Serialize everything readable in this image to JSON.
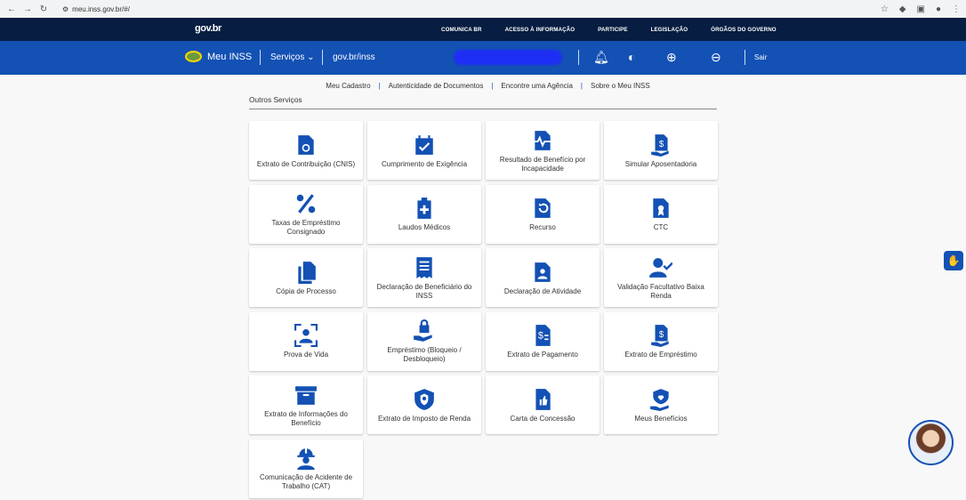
{
  "browser": {
    "url": "meu.inss.gov.br/#/"
  },
  "govbar": {
    "logo": "gov.br",
    "links": [
      "COMUNICA BR",
      "ACESSO À INFORMAÇÃO",
      "PARTICIPE",
      "LEGISLAÇÃO",
      "ÓRGÃOS DO GOVERNO"
    ]
  },
  "header": {
    "brand": "Meu INSS",
    "servicos": "Serviços",
    "govlink": "gov.br/inss",
    "sair": "Sair"
  },
  "subnav": [
    "Meu Cadastro",
    "Autenticidade de Documentos",
    "Encontre uma Agência",
    "Sobre o Meu INSS"
  ],
  "section": {
    "title": "Outros Serviços"
  },
  "cards": [
    {
      "label": "Extrato de Contribuição (CNIS)",
      "icon": "piggy-bank-doc-icon"
    },
    {
      "label": "Cumprimento de Exigência",
      "icon": "calendar-check-icon"
    },
    {
      "label": "Resultado de Benefício por Incapacidade",
      "icon": "heartbeat-doc-icon"
    },
    {
      "label": "Simular Aposentadoria",
      "icon": "money-doc-hand-icon"
    },
    {
      "label": "Taxas de Empréstimo Consignado",
      "icon": "percent-icon"
    },
    {
      "label": "Laudos Médicos",
      "icon": "medical-clipboard-icon"
    },
    {
      "label": "Recurso",
      "icon": "undo-doc-icon"
    },
    {
      "label": "CTC",
      "icon": "certificate-doc-icon"
    },
    {
      "label": "Cópia de Processo",
      "icon": "copy-icon"
    },
    {
      "label": "Declaração de Beneficiário do INSS",
      "icon": "receipt-icon"
    },
    {
      "label": "Declaração de Atividade",
      "icon": "worker-doc-icon"
    },
    {
      "label": "Validação Facultativo Baixa Renda",
      "icon": "user-check-icon"
    },
    {
      "label": "Prova de Vida",
      "icon": "face-scan-icon"
    },
    {
      "label": "Empréstimo (Bloqueio / Desbloqueio)",
      "icon": "lock-hand-icon"
    },
    {
      "label": "Extrato de Pagamento",
      "icon": "dollar-doc-icon"
    },
    {
      "label": "Extrato de Empréstimo",
      "icon": "money-doc-hand-icon"
    },
    {
      "label": "Extrato de Informações do Benefício",
      "icon": "archive-box-icon"
    },
    {
      "label": "Extrato de Imposto de Renda",
      "icon": "lion-shield-icon"
    },
    {
      "label": "Carta de Concessão",
      "icon": "thumbs-up-doc-icon"
    },
    {
      "label": "Meus Benefícios",
      "icon": "heart-hand-icon"
    },
    {
      "label": "Comunicação de Acidente de Trabalho (CAT)",
      "icon": "hard-hat-worker-icon"
    }
  ],
  "colors": {
    "govbar_bg": "#071d41",
    "header_bg": "#1351b4",
    "icon": "#1351b4"
  }
}
